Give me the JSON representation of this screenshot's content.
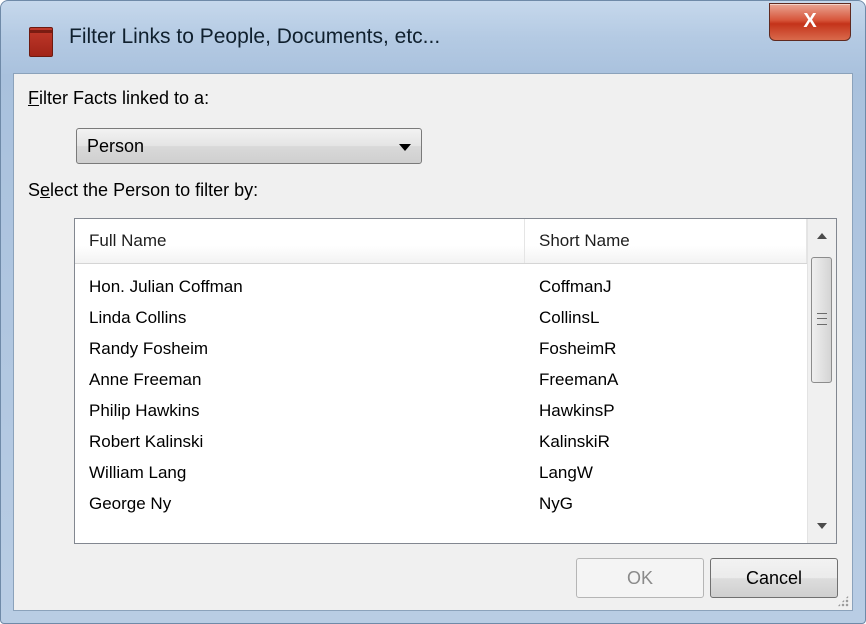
{
  "window": {
    "title": "Filter Links to People, Documents, etc...",
    "close_label": "X"
  },
  "filter_type": {
    "label_prefix": "F",
    "label_rest": "ilter Facts linked to a:",
    "selected": "Person"
  },
  "select_label": {
    "prefix": "S",
    "underlined": "e",
    "rest": "lect the Person to filter by:"
  },
  "table": {
    "columns": [
      "Full Name",
      "Short Name"
    ],
    "rows": [
      {
        "full": "Hon. Julian Coffman",
        "short": "CoffmanJ"
      },
      {
        "full": "Linda Collins",
        "short": "CollinsL"
      },
      {
        "full": "Randy Fosheim",
        "short": "FosheimR"
      },
      {
        "full": "Anne Freeman",
        "short": "FreemanA"
      },
      {
        "full": "Philip Hawkins",
        "short": "HawkinsP"
      },
      {
        "full": "Robert Kalinski",
        "short": "KalinskiR"
      },
      {
        "full": "William Lang",
        "short": "LangW"
      },
      {
        "full": "George Ny",
        "short": "NyG"
      }
    ]
  },
  "buttons": {
    "ok": "OK",
    "cancel": "Cancel"
  }
}
